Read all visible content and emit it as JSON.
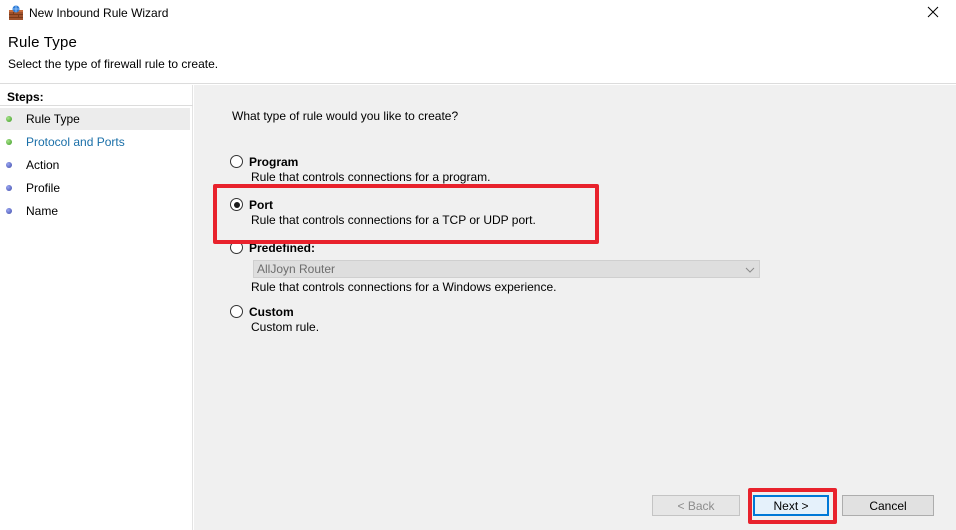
{
  "window": {
    "title": "New Inbound Rule Wizard"
  },
  "header": {
    "title": "Rule Type",
    "subtitle": "Select the type of firewall rule to create."
  },
  "sidebar": {
    "steps_label": "Steps:",
    "steps": [
      {
        "label": "Rule Type",
        "status": "done",
        "color": "#3c9a22",
        "text_color": "#000000"
      },
      {
        "label": "Protocol and Ports",
        "status": "done",
        "color": "#3c9a22",
        "text_color": "#1a6fa8"
      },
      {
        "label": "Action",
        "status": "pending",
        "color": "#3d4aa8",
        "text_color": "#000000"
      },
      {
        "label": "Profile",
        "status": "pending",
        "color": "#3d4aa8",
        "text_color": "#000000"
      },
      {
        "label": "Name",
        "status": "pending",
        "color": "#3d4aa8",
        "text_color": "#000000"
      }
    ]
  },
  "main": {
    "question": "What type of rule would you like to create?",
    "options": {
      "program": {
        "title": "Program",
        "desc": "Rule that controls connections for a program.",
        "selected": false
      },
      "port": {
        "title": "Port",
        "desc": "Rule that controls connections for a TCP or UDP port.",
        "selected": true
      },
      "predefined": {
        "title": "Predefined:",
        "desc": "Rule that controls connections for a Windows experience.",
        "selected": false,
        "select_value": "AllJoyn Router"
      },
      "custom": {
        "title": "Custom",
        "desc": "Custom rule.",
        "selected": false
      }
    }
  },
  "footer": {
    "back_label": "< Back",
    "next_label": "Next >",
    "cancel_label": "Cancel"
  },
  "colors": {
    "highlight": "#e8222c",
    "focus": "#0078d7",
    "panel_bg": "#f0f0f0"
  }
}
